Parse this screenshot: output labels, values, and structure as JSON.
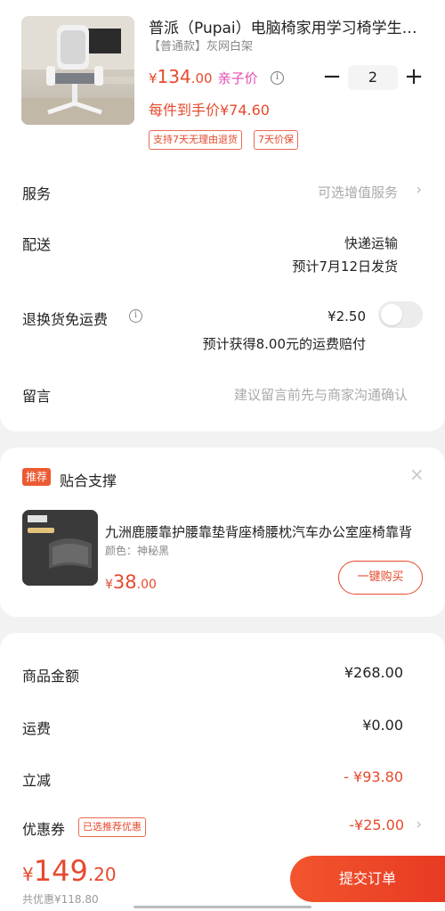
{
  "product": {
    "title": "普派（Pupai）电脑椅家用学习椅学生椅人体工学椅",
    "spec": "【普通款】灰网白架",
    "price_currency": "¥",
    "price_int": "134",
    "price_dec": ".00",
    "price_tag": "亲子价",
    "quantity": "2",
    "unit_price": "每件到手价¥74.60",
    "promo_tags": [
      "支持7天无理由退货",
      "7天价保"
    ]
  },
  "rows": {
    "service_label": "服务",
    "service_value": "可选增值服务",
    "delivery_label": "配送",
    "delivery_method": "快递运输",
    "delivery_eta": "预计7月12日发货",
    "return_label": "退换货免运费",
    "return_price": "¥2.50",
    "return_note": "预计获得8.00元的运费赔付",
    "return_enabled": false,
    "message_label": "留言",
    "message_placeholder": "建议留言前先与商家沟通确认"
  },
  "recommend": {
    "badge": "推荐",
    "title": "贴合支撑",
    "name": "九洲鹿腰靠护腰靠垫背座椅腰枕汽车办公室座椅靠背",
    "spec": "颜色：神秘黑",
    "price_currency": "¥",
    "price_int": "38",
    "price_dec": ".00",
    "buy_label": "一键购买"
  },
  "summary": {
    "goods_label": "商品金额",
    "goods_value": "¥268.00",
    "shipping_label": "运费",
    "shipping_value": "¥0.00",
    "discount_label": "立减",
    "discount_value": "- ¥93.80",
    "coupon_label": "优惠券",
    "coupon_tag": "已选推荐优惠",
    "coupon_value": "-¥25.00"
  },
  "bottom": {
    "total_currency": "¥",
    "total_int": "149",
    "total_dec": ".20",
    "total_saving": "共优惠¥118.80",
    "submit_label": "提交订单"
  },
  "colors": {
    "accent": "#e64a2e",
    "pink": "#e54cb0",
    "page_bg": "#f2f2f2"
  }
}
